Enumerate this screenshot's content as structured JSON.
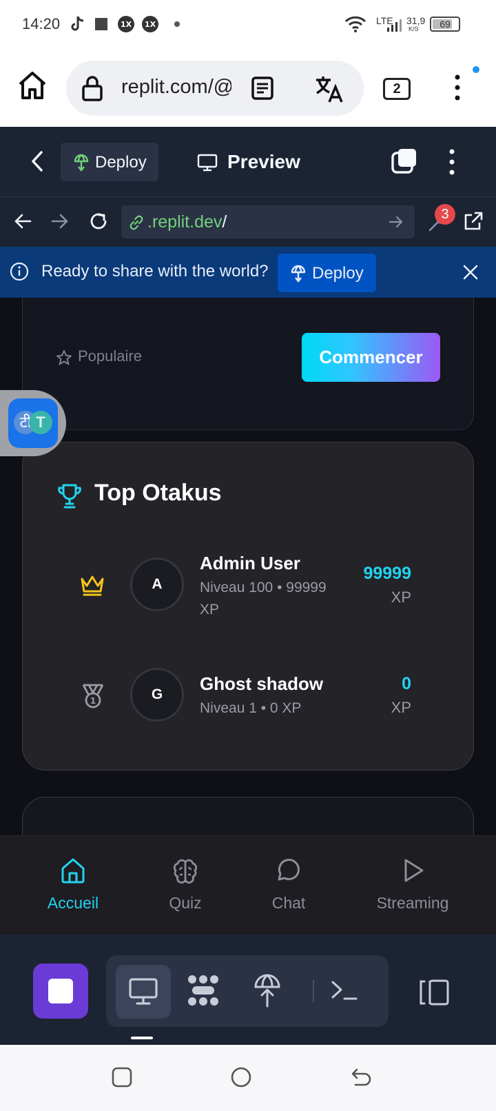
{
  "status_bar": {
    "time": "14:20",
    "network": "LTE",
    "speed_value": "31,9",
    "speed_unit": "K/S",
    "battery": "69"
  },
  "browser": {
    "url": "replit.com/@",
    "tab_count": "2"
  },
  "replit_header": {
    "deploy_tab": "Deploy",
    "preview_tab": "Preview"
  },
  "webview": {
    "url_domain": ".replit.dev",
    "url_path": "/",
    "devtools_badge": "3"
  },
  "banner": {
    "message": "Ready to share with the world?",
    "deploy_button": "Deploy"
  },
  "app": {
    "popular_label": "Populaire",
    "start_button": "Commencer",
    "leaderboard": {
      "title": "Top Otakus",
      "entries": [
        {
          "initial": "A",
          "name": "Admin User",
          "level_line_1": "Niveau 100 • 99999",
          "level_line_2": "XP",
          "xp": "99999",
          "xp_unit": "XP",
          "rank_icon": "crown-icon"
        },
        {
          "initial": "G",
          "name": "Ghost shadow",
          "level_line_1": "Niveau 1 • 0 XP",
          "level_line_2": "",
          "xp": "0",
          "xp_unit": "XP",
          "rank_icon": "medal-icon"
        }
      ]
    },
    "nav": [
      {
        "label": "Accueil",
        "icon": "home-icon",
        "active": true
      },
      {
        "label": "Quiz",
        "icon": "brain-icon",
        "active": false
      },
      {
        "label": "Chat",
        "icon": "chat-bubble-icon",
        "active": false
      },
      {
        "label": "Streaming",
        "icon": "play-icon",
        "active": false
      }
    ]
  },
  "floating_widget": {
    "glyph_hindi": "टी",
    "glyph_latin": "T"
  },
  "colors": {
    "accent_cyan": "#22d3ee",
    "replit_bg": "#1c2333",
    "banner_blue": "#0a3a7a",
    "stop_purple": "#6a3bd6",
    "crown_gold": "#f5c518",
    "badge_red": "#e5484d"
  }
}
